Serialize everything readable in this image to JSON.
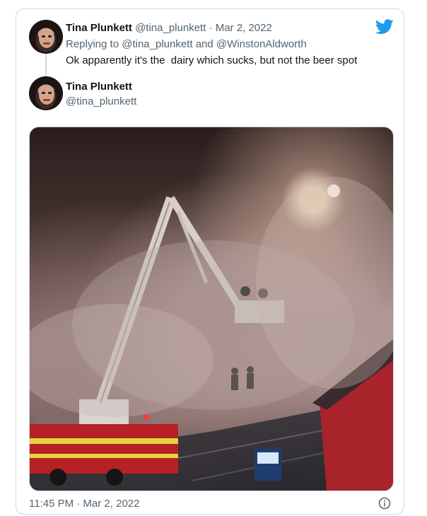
{
  "tweet": {
    "display_name": "Tina Plunkett",
    "handle": "@tina_plunkett",
    "separator": "·",
    "date": "Mar 2, 2022",
    "replying_prefix": "Replying to",
    "replying_user1": "@tina_plunkett",
    "replying_and": "and",
    "replying_user2": "@WinstonAldworth",
    "text": "Ok apparently it's the  dairy which sucks, but not the beer spot"
  },
  "quoted": {
    "display_name": "Tina Plunkett",
    "handle": "@tina_plunkett",
    "timestamp": "11:45 PM · Mar 2, 2022"
  },
  "icons": {
    "logo": "twitter-bird-icon",
    "info": "info-icon"
  },
  "colors": {
    "brand": "#1d9bf0",
    "muted": "#536471",
    "border": "#cfd9de"
  }
}
